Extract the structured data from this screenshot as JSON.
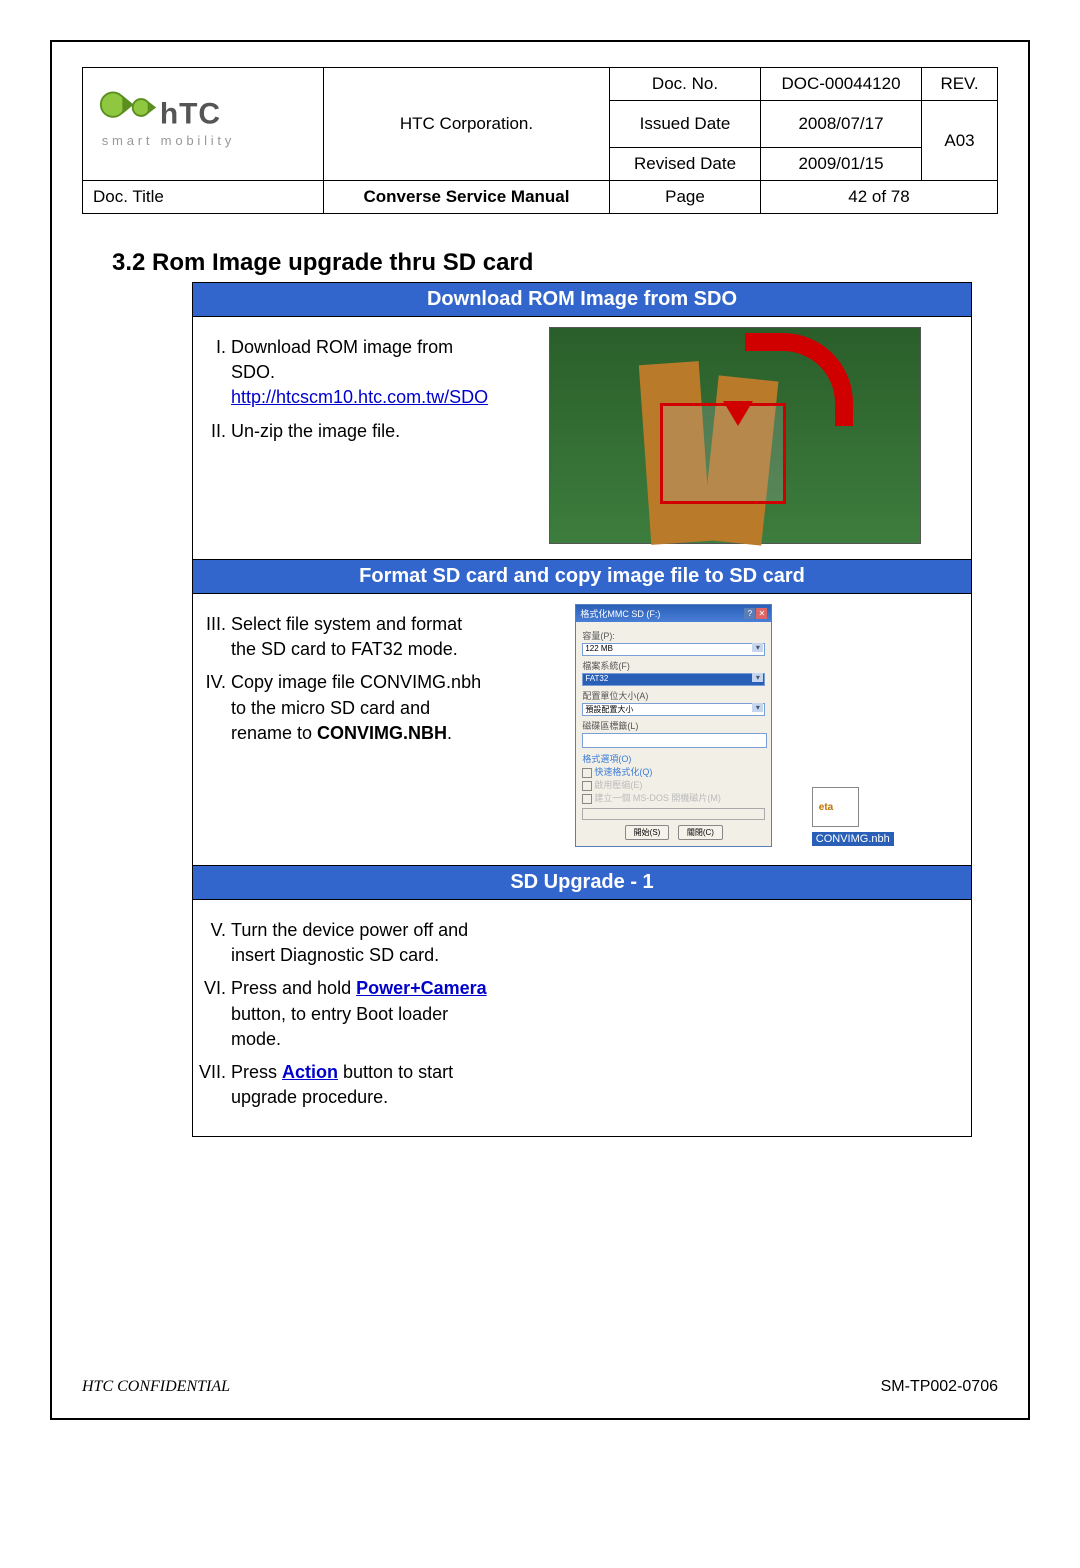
{
  "header": {
    "company": "HTC Corporation.",
    "doc_no_label": "Doc. No.",
    "doc_no": "DOC-00044120",
    "issued_label": "Issued Date",
    "issued": "2008/07/17",
    "revised_label": "Revised Date",
    "revised": "2009/01/15",
    "rev_label": "REV.",
    "rev": "A03",
    "doctitle_label": "Doc. Title",
    "doctitle": "Converse Service Manual",
    "page_label": "Page",
    "page": "42  of  78",
    "logo_text": "smart mobility"
  },
  "section": {
    "title": "3.2  Rom Image upgrade thru SD card",
    "block1_header": "Download ROM Image from SDO",
    "block2_header": "Format SD card and copy image file to SD card",
    "block3_header": "SD Upgrade - 1",
    "step1_a": "Download ROM image from SDO.",
    "link": "http://htcscm10.htc.com.tw/SDO",
    "step2": "Un-zip the image file.",
    "step3": "Select file system and format the SD card to FAT32 mode.",
    "step4_a": "Copy image file CONVIMG.nbh to the micro SD card and rename to ",
    "step4_b": "CONVIMG.NBH",
    "step4_c": ".",
    "step5": "Turn the device power off and insert Diagnostic SD card.",
    "step6_a": "Press and hold ",
    "step6_b": "Power+Camera",
    "step6_c": " button, to entry Boot loader mode.",
    "step7_a": "Press ",
    "step7_b": "Action",
    "step7_c": " button to start upgrade procedure."
  },
  "dialog": {
    "title": "格式化MMC   SD (F:)",
    "capacity_label": "容量(P):",
    "capacity_value": "122 MB",
    "fs_label": "檔案系統(F)",
    "fs_value": "FAT32",
    "alloc_label": "配置單位大小(A)",
    "alloc_value": "預設配置大小",
    "vol_label": "磁碟區標籤(L)",
    "options": "格式選項(O)",
    "opt_quick": "快速格式化(Q)",
    "opt_comp": "啟用壓縮(E)",
    "opt_boot": "建立一個 MS-DOS 開機磁片(M)",
    "btn_start": "開始(S)",
    "btn_close": "關閉(C)",
    "file_name": "CONVIMG.nbh"
  },
  "footer": {
    "confidential": "HTC CONFIDENTIAL",
    "form_no": "SM-TP002-0706"
  }
}
